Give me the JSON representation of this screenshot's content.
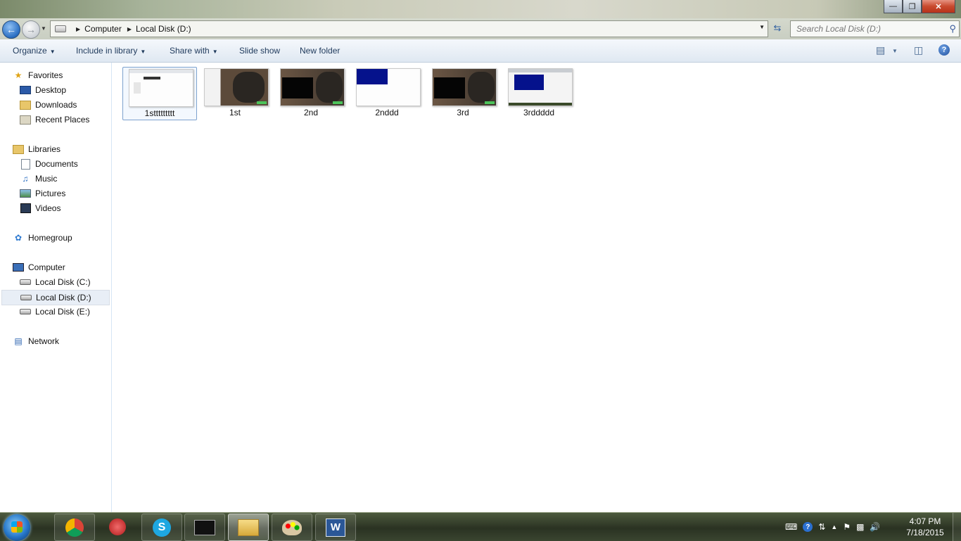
{
  "window": {
    "min_icon": "minimize-glyph",
    "max_icon": "restore-glyph",
    "close_icon": "close-glyph"
  },
  "address_bar": {
    "crumbs": [
      "Computer",
      "Local Disk (D:)"
    ]
  },
  "search": {
    "placeholder": "Search Local Disk (D:)"
  },
  "toolbar": {
    "organize": "Organize",
    "include_in_library": "Include in library",
    "share_with": "Share with",
    "slide_show": "Slide show",
    "new_folder": "New folder",
    "help": "?"
  },
  "nav": {
    "favorites": "Favorites",
    "desktop": "Desktop",
    "downloads": "Downloads",
    "recent_places": "Recent Places",
    "libraries": "Libraries",
    "documents": "Documents",
    "music": "Music",
    "pictures": "Pictures",
    "videos": "Videos",
    "homegroup": "Homegroup",
    "computer": "Computer",
    "disk_c": "Local Disk (C:)",
    "disk_d": "Local Disk (D:)",
    "disk_e": "Local Disk (E:)",
    "network": "Network"
  },
  "files": [
    {
      "name": "1sttttttttt",
      "selected": true,
      "thumb": "white-screen"
    },
    {
      "name": "1st",
      "selected": false,
      "thumb": "elephant"
    },
    {
      "name": "2nd",
      "selected": false,
      "thumb": "elephant-black"
    },
    {
      "name": "2nddd",
      "selected": false,
      "thumb": "blue-window"
    },
    {
      "name": "3rd",
      "selected": false,
      "thumb": "elephant-black"
    },
    {
      "name": "3rddddd",
      "selected": false,
      "thumb": "blue-window-framed"
    }
  ],
  "clock": {
    "time": "4:07 PM",
    "date": "7/18/2015"
  },
  "colors": {
    "accent": "#1e395b",
    "selection": "#7da2ce"
  }
}
